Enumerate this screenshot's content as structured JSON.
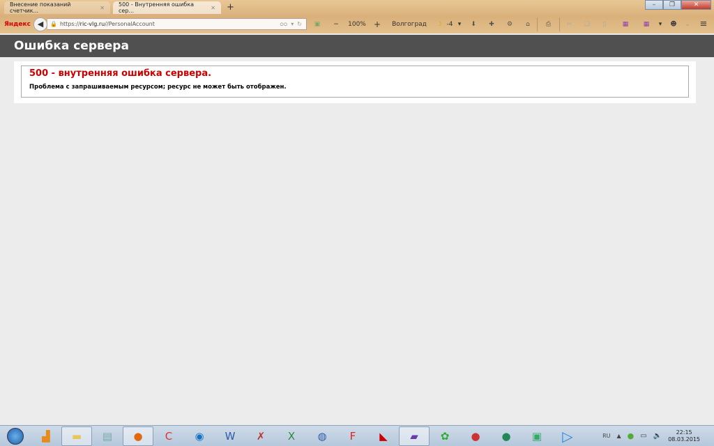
{
  "browser": {
    "tabs": [
      {
        "label": "Внесение показаний счетчик...",
        "active": false
      },
      {
        "label": "500 - Внутренняя ошибка сер...",
        "active": true
      }
    ],
    "new_tab": "+",
    "brand": "Яндекс",
    "url_scheme": "https://",
    "url_host": "ric-vlg.ru",
    "url_path": "//PersonalAccount",
    "zoom": "100%",
    "zoom_out": "−",
    "zoom_in": "+",
    "city": "Волгоград",
    "weather_temp": "-4"
  },
  "page": {
    "header": "Ошибка сервера",
    "error_title": "500 - внутренняя ошибка сервера.",
    "error_text": "Проблема с запрашиваемым ресурсом; ресурс не может быть отображен."
  },
  "taskbar": {
    "language": "RU",
    "time": "22:15",
    "date": "08.03.2015",
    "apps": [
      "start",
      "app-2",
      "explorer",
      "calculator",
      "firefox",
      "ccleaner",
      "app-c",
      "word",
      "access",
      "excel",
      "google-earth",
      "app-fr",
      "acrobat",
      "visual-studio",
      "app-colors",
      "app-red",
      "app-green",
      "app-remote",
      "media-player"
    ]
  }
}
